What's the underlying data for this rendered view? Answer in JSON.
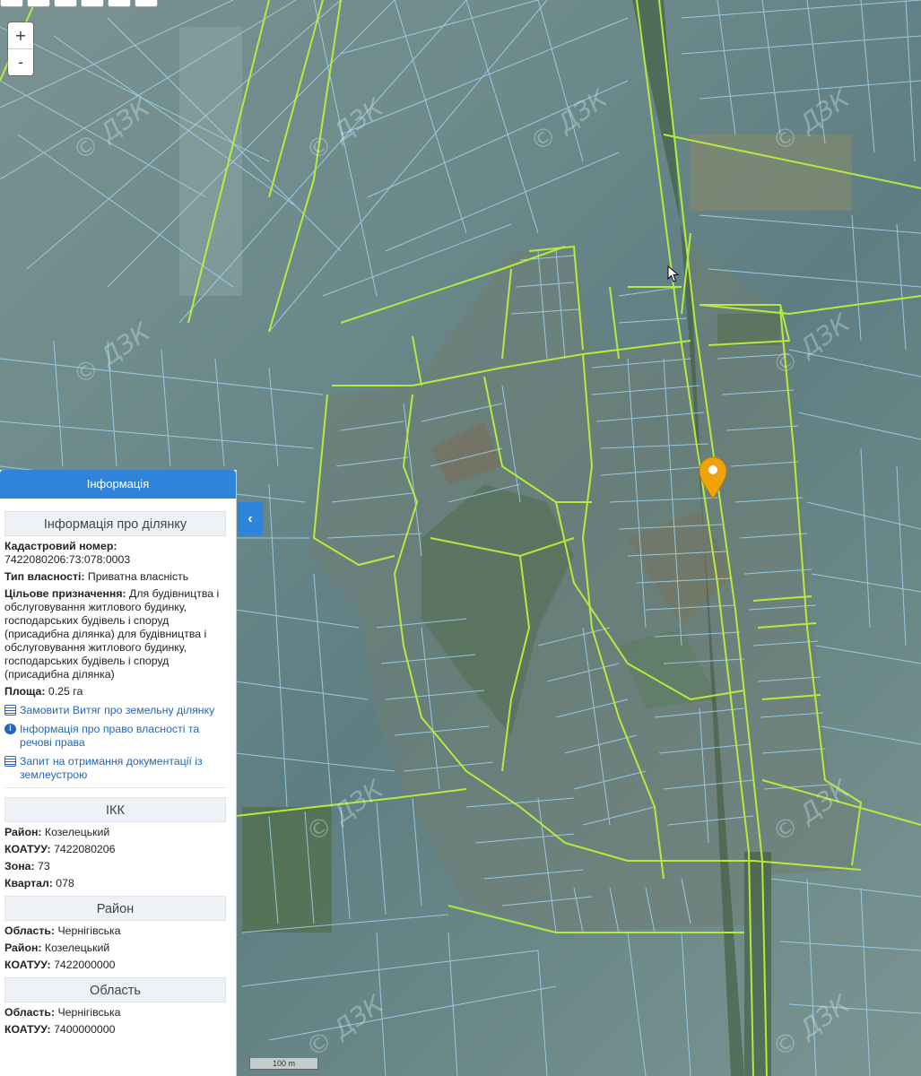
{
  "map": {
    "zoom_in": "+",
    "zoom_out": "-",
    "scale": "100 m",
    "watermark": "© ДЗК",
    "marker_color": "#f0a30a"
  },
  "panel": {
    "header": "Інформація",
    "collapse_icon": "‹",
    "parcel": {
      "title": "Інформація про ділянку",
      "cadastral_label": "Кадастровий номер:",
      "cadastral_value": "7422080206:73:078:0003",
      "ownership_label": "Тип власності:",
      "ownership_value": "Приватна власність",
      "purpose_label": "Цільове призначення:",
      "purpose_value": "Для будівництва і обслуговування житлового будинку, господарських будівель і споруд (присадибна ділянка) для будівництва і обслуговування житлового будинку, господарських будівель і споруд (присадибна ділянка)",
      "area_label": "Площа:",
      "area_value": "0.25 га"
    },
    "links": [
      "Замовити Витяг про земельну ділянку",
      "Інформація про право власності та речові права",
      "Запит на отримання документації із землеустрою"
    ],
    "ikk": {
      "title": "ІКК",
      "district_label": "Район:",
      "district_value": "Козелецький",
      "koatuu_label": "КОАТУУ:",
      "koatuu_value": "7422080206",
      "zone_label": "Зона:",
      "zone_value": "73",
      "quarter_label": "Квартал:",
      "quarter_value": "078"
    },
    "district": {
      "title": "Район",
      "region_label": "Область:",
      "region_value": "Чернігівська",
      "district_label": "Район:",
      "district_value": "Козелецький",
      "koatuu_label": "КОАТУУ:",
      "koatuu_value": "7422000000"
    },
    "region": {
      "title": "Область",
      "region_label": "Область:",
      "region_value": "Чернігівська",
      "koatuu_label": "КОАТУУ:",
      "koatuu_value": "7400000000"
    }
  }
}
